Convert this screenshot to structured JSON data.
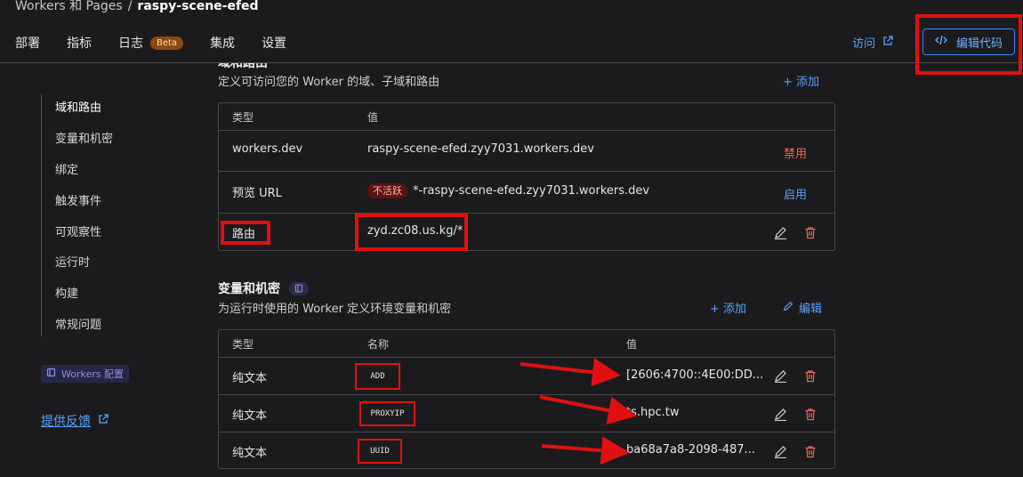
{
  "breadcrumb": {
    "parent": "Workers 和 Pages",
    "separator": "/",
    "project": "raspy-scene-efed"
  },
  "tabs": [
    "部署",
    "指标",
    "日志",
    "集成",
    "设置"
  ],
  "logs_badge": "Beta",
  "header": {
    "visit_label": "访问",
    "edit_code_label": "编辑代码"
  },
  "sidebar": {
    "items": [
      "域和路由",
      "变量和机密",
      "绑定",
      "触发事件",
      "可观察性",
      "运行时",
      "构建",
      "常规问题"
    ],
    "workers_config": "Workers 配置",
    "feedback": "提供反馈"
  },
  "domains": {
    "title_partial": "域和路由",
    "description": "定义可访问您的 Worker 的域、子域和路由",
    "add_label": "+ 添加",
    "columns": [
      "类型",
      "值"
    ],
    "rows": [
      {
        "type": "workers.dev",
        "value": "raspy-scene-efed.zyy7031.workers.dev",
        "action": "禁用"
      },
      {
        "type": "预览 URL",
        "badge": "不活跃",
        "value": "*-raspy-scene-efed.zyy7031.workers.dev",
        "action": "启用"
      },
      {
        "type": "路由",
        "value": "zyd.zc08.us.kg/*"
      }
    ]
  },
  "variables": {
    "title": "变量和机密",
    "description": "为运行时使用的 Worker 定义环境变量和机密",
    "add_label": "+ 添加",
    "edit_label": "编辑",
    "columns": [
      "类型",
      "名称",
      "值"
    ],
    "rows": [
      {
        "type": "纯文本",
        "name": "ADD",
        "value": "[2606:4700::4E00:DD..."
      },
      {
        "type": "纯文本",
        "name": "PROXYIP",
        "value": "ts.hpc.tw"
      },
      {
        "type": "纯文本",
        "name": "UUID",
        "value": "ba68a7a8-2098-487..."
      }
    ]
  },
  "colors": {
    "accent": "#5aa2ff",
    "danger": "#f0685a",
    "highlight": "#e01010",
    "background": "#1b1b1d"
  },
  "icons": [
    "external-link-icon",
    "code-icon",
    "pencil-icon",
    "trash-icon",
    "book-icon"
  ]
}
